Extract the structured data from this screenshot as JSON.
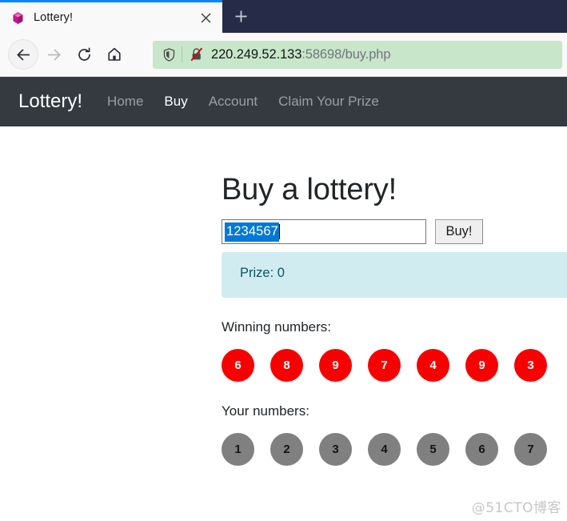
{
  "browser": {
    "tab": {
      "title": "Lottery!",
      "favicon": "gem-icon",
      "close_label": "×"
    },
    "new_tab_label": "+",
    "toolbar": {
      "back_icon": "back-arrow-icon",
      "forward_icon": "forward-arrow-icon",
      "reload_icon": "reload-icon",
      "home_icon": "home-icon"
    },
    "address_bar": {
      "shield_icon": "shield-icon",
      "security_icon": "insecure-lock-icon",
      "host": "220.249.52.133",
      "rest": ":58698/buy.php"
    }
  },
  "site": {
    "brand": "Lottery!",
    "nav": [
      {
        "label": "Home",
        "active": false
      },
      {
        "label": "Buy",
        "active": true
      },
      {
        "label": "Account",
        "active": false
      },
      {
        "label": "Claim Your Prize",
        "active": false
      }
    ]
  },
  "main": {
    "title": "Buy a lottery!",
    "input": {
      "value": "1234567",
      "placeholder": ""
    },
    "buy_button": "Buy!",
    "prize_alert": "Prize: 0",
    "winning_label": "Winning numbers:",
    "winning_numbers": [
      "6",
      "8",
      "9",
      "7",
      "4",
      "9",
      "3"
    ],
    "your_label": "Your numbers:",
    "your_numbers": [
      "1",
      "2",
      "3",
      "4",
      "5",
      "6",
      "7"
    ]
  },
  "watermark": "@51CTO博客",
  "colors": {
    "titlebar": "#262b47",
    "tab_accent": "#0a84ff",
    "urlbar_bg": "#c8e6c9",
    "site_navbar": "#343a40",
    "alert_bg": "#d1ecf1",
    "alert_text": "#0c5460",
    "winning_ball": "#f80000",
    "your_ball": "#808080",
    "selection": "#0078d7"
  }
}
